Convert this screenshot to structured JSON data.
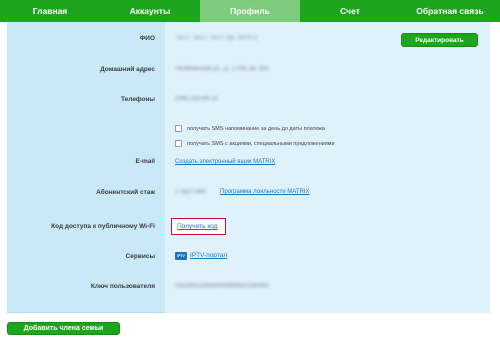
{
  "nav": {
    "items": [
      "Главная",
      "Аккаунты",
      "Профиль",
      "Счет",
      "Обратная связь"
    ],
    "active": "Профиль"
  },
  "profile": {
    "fio_label": "ФИО",
    "fio_value": "ТЕСТ ТЕСТ ТЕСТ (гр. 1979 г.)",
    "edit_button": "Редактировать",
    "address_label": "Домашний адрес",
    "address_value": "Челябинская ул., д. 17/44, кв. 856",
    "phones_label": "Телефоны",
    "phones_value": "(066) 555-66-22",
    "sms_payment": "получать SMS напоминание за день до даты платежа",
    "sms_promo": "получать SMS с акциями, специальными предложениями",
    "email_label": "E-mail",
    "email_link": "Создать электронный ящик MATRIX",
    "tenure_label": "Абонентский стаж",
    "tenure_value": "1 год 5 мес.",
    "loyalty_link": "Программа лояльности MATRIX",
    "wifi_label": "Код доступа к публичному Wi-Fi",
    "wifi_link": "Получить код",
    "services_label": "Сервисы",
    "iptv_icon_text": "IPTV",
    "iptv_link": "IPTV-портал",
    "user_key_label": "Ключ пользователя",
    "user_key_value": "f1b2a9ecu4bea0f0d4b6a5c0ae99f1"
  },
  "add_family_button": "Добавить члена семьи",
  "colors": {
    "green": "#1ea51e",
    "nav_active": "#7dcb7d",
    "panel_left": "#c9e9f8",
    "panel_right": "#dff2fb",
    "link": "#1e73be",
    "highlight": "#c8102e"
  }
}
